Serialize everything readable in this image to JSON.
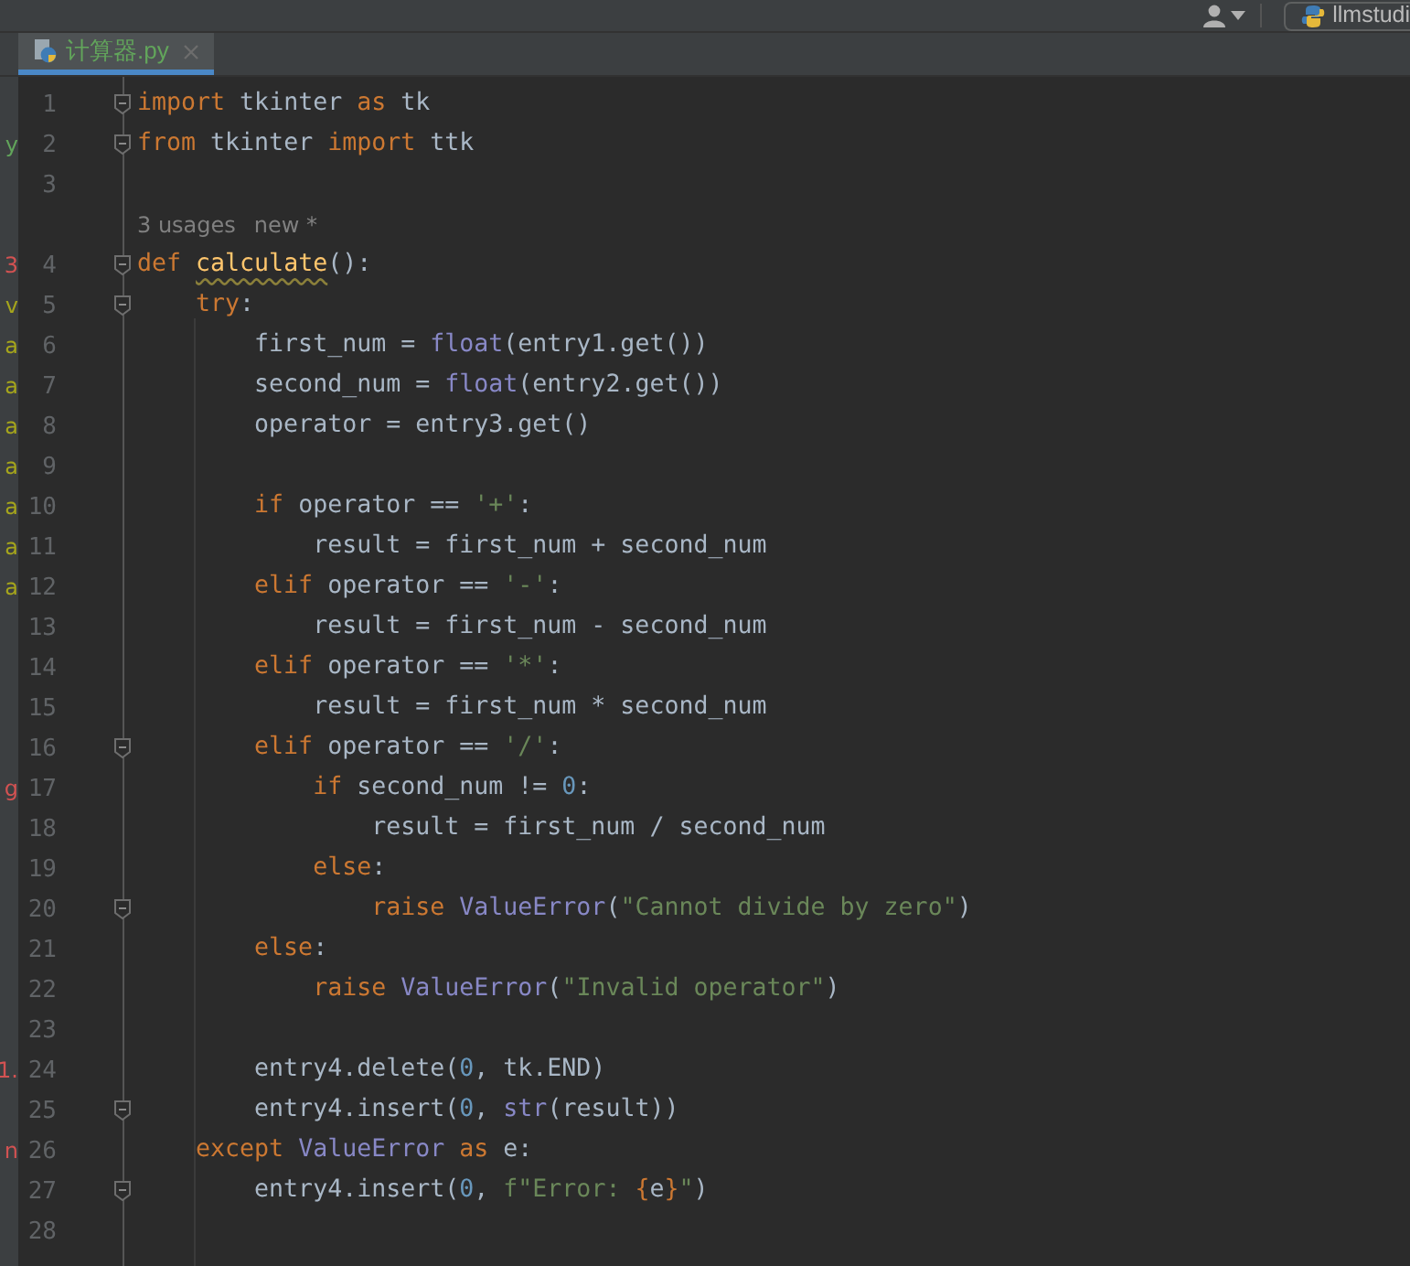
{
  "toolbar": {
    "run_config": "llmstudi"
  },
  "tabs": [
    {
      "label": "计算器.py",
      "selected": true
    }
  ],
  "lines": [
    {
      "number": "1",
      "fold": true,
      "tokens": [
        {
          "kind": "kw",
          "text": "import"
        },
        {
          "kind": "plain",
          "text": " tkinter "
        },
        {
          "kind": "kw",
          "text": "as"
        },
        {
          "kind": "plain",
          "text": " tk"
        }
      ]
    },
    {
      "number": "2",
      "fold": true,
      "strip": {
        "text": "y",
        "color": "#62a55b"
      },
      "tokens": [
        {
          "kind": "kw",
          "text": "from"
        },
        {
          "kind": "plain",
          "text": " tkinter "
        },
        {
          "kind": "kw",
          "text": "import"
        },
        {
          "kind": "plain",
          "text": " ttk"
        }
      ]
    },
    {
      "number": "3",
      "fold": false
    },
    {
      "kind": "hint",
      "usages": "3 usages",
      "author": "new *"
    },
    {
      "number": "4",
      "fold": true,
      "strip": {
        "text": "3",
        "color": "#d25252"
      },
      "tokens": [
        {
          "kind": "kw",
          "text": "def "
        },
        {
          "kind": "fn",
          "text": "calculate"
        },
        {
          "kind": "plain",
          "text": "():"
        }
      ]
    },
    {
      "number": "5",
      "fold": true,
      "strip": {
        "text": "v",
        "color": "#a5a51c"
      },
      "tokens": [
        {
          "kind": "kw",
          "text": "    try"
        },
        {
          "kind": "plain",
          "text": ":"
        }
      ]
    },
    {
      "number": "6",
      "fold": false,
      "strip": {
        "text": "a",
        "color": "#a5a51c"
      },
      "tokens": [
        {
          "kind": "plain",
          "text": "        first_num = "
        },
        {
          "kind": "builtin",
          "text": "float"
        },
        {
          "kind": "plain",
          "text": "(entry1.get())"
        }
      ]
    },
    {
      "number": "7",
      "fold": false,
      "strip": {
        "text": "a",
        "color": "#a5a51c"
      },
      "tokens": [
        {
          "kind": "plain",
          "text": "        second_num = "
        },
        {
          "kind": "builtin",
          "text": "float"
        },
        {
          "kind": "plain",
          "text": "(entry2.get())"
        }
      ]
    },
    {
      "number": "8",
      "fold": false,
      "strip": {
        "text": "a",
        "color": "#a5a51c"
      },
      "tokens": [
        {
          "kind": "plain",
          "text": "        operator = entry3.get()"
        }
      ]
    },
    {
      "number": "9",
      "fold": false,
      "strip": {
        "text": "a",
        "color": "#a5a51c"
      }
    },
    {
      "number": "10",
      "fold": false,
      "strip": {
        "text": "a",
        "color": "#a5a51c"
      },
      "tokens": [
        {
          "kind": "kw",
          "text": "        if"
        },
        {
          "kind": "plain",
          "text": " operator == "
        },
        {
          "kind": "str",
          "text": "'+'"
        },
        {
          "kind": "plain",
          "text": ":"
        }
      ]
    },
    {
      "number": "11",
      "fold": false,
      "strip": {
        "text": "a",
        "color": "#a5a51c"
      },
      "tokens": [
        {
          "kind": "plain",
          "text": "            result = first_num + second_num"
        }
      ]
    },
    {
      "number": "12",
      "fold": false,
      "strip": {
        "text": "a",
        "color": "#a5a51c"
      },
      "tokens": [
        {
          "kind": "kw",
          "text": "        elif"
        },
        {
          "kind": "plain",
          "text": " operator == "
        },
        {
          "kind": "str",
          "text": "'-'"
        },
        {
          "kind": "plain",
          "text": ":"
        }
      ]
    },
    {
      "number": "13",
      "fold": false,
      "tokens": [
        {
          "kind": "plain",
          "text": "            result = first_num - second_num"
        }
      ]
    },
    {
      "number": "14",
      "fold": false,
      "tokens": [
        {
          "kind": "kw",
          "text": "        elif"
        },
        {
          "kind": "plain",
          "text": " operator == "
        },
        {
          "kind": "str",
          "text": "'*'"
        },
        {
          "kind": "plain",
          "text": ":"
        }
      ]
    },
    {
      "number": "15",
      "fold": false,
      "tokens": [
        {
          "kind": "plain",
          "text": "            result = first_num * second_num"
        }
      ]
    },
    {
      "number": "16",
      "fold": true,
      "tokens": [
        {
          "kind": "kw",
          "text": "        elif"
        },
        {
          "kind": "plain",
          "text": " operator == "
        },
        {
          "kind": "str",
          "text": "'/'"
        },
        {
          "kind": "plain",
          "text": ":"
        }
      ]
    },
    {
      "number": "17",
      "fold": false,
      "strip": {
        "text": "g",
        "color": "#d25252"
      },
      "tokens": [
        {
          "kind": "kw",
          "text": "            if"
        },
        {
          "kind": "plain",
          "text": " second_num != "
        },
        {
          "kind": "num",
          "text": "0"
        },
        {
          "kind": "plain",
          "text": ":"
        }
      ]
    },
    {
      "number": "18",
      "fold": false,
      "tokens": [
        {
          "kind": "plain",
          "text": "                result = first_num / second_num"
        }
      ]
    },
    {
      "number": "19",
      "fold": false,
      "tokens": [
        {
          "kind": "kw",
          "text": "            else"
        },
        {
          "kind": "plain",
          "text": ":"
        }
      ]
    },
    {
      "number": "20",
      "fold": true,
      "tokens": [
        {
          "kind": "kw",
          "text": "                raise "
        },
        {
          "kind": "builtin",
          "text": "ValueError"
        },
        {
          "kind": "plain",
          "text": "("
        },
        {
          "kind": "str",
          "text": "\"Cannot divide by zero\""
        },
        {
          "kind": "plain",
          "text": ")"
        }
      ]
    },
    {
      "number": "21",
      "fold": false,
      "tokens": [
        {
          "kind": "kw",
          "text": "        else"
        },
        {
          "kind": "plain",
          "text": ":"
        }
      ]
    },
    {
      "number": "22",
      "fold": false,
      "tokens": [
        {
          "kind": "kw",
          "text": "            raise "
        },
        {
          "kind": "builtin",
          "text": "ValueError"
        },
        {
          "kind": "plain",
          "text": "("
        },
        {
          "kind": "str",
          "text": "\"Invalid operator\""
        },
        {
          "kind": "plain",
          "text": ")"
        }
      ]
    },
    {
      "number": "23",
      "fold": false
    },
    {
      "number": "24",
      "fold": false,
      "strip": {
        "text": "1.",
        "color": "#d25252"
      },
      "tokens": [
        {
          "kind": "plain",
          "text": "        entry4.delete("
        },
        {
          "kind": "num",
          "text": "0"
        },
        {
          "kind": "plain",
          "text": ", tk.END)"
        }
      ]
    },
    {
      "number": "25",
      "fold": true,
      "tokens": [
        {
          "kind": "plain",
          "text": "        entry4.insert("
        },
        {
          "kind": "num",
          "text": "0"
        },
        {
          "kind": "plain",
          "text": ", "
        },
        {
          "kind": "builtin",
          "text": "str"
        },
        {
          "kind": "plain",
          "text": "(result))"
        }
      ]
    },
    {
      "number": "26",
      "fold": false,
      "strip": {
        "text": "n",
        "color": "#d25252"
      },
      "tokens": [
        {
          "kind": "kw",
          "text": "    except "
        },
        {
          "kind": "builtin",
          "text": "ValueError"
        },
        {
          "kind": "kw",
          "text": " as"
        },
        {
          "kind": "plain",
          "text": " e:"
        }
      ]
    },
    {
      "number": "27",
      "fold": true,
      "tokens": [
        {
          "kind": "plain",
          "text": "        entry4.insert("
        },
        {
          "kind": "num",
          "text": "0"
        },
        {
          "kind": "plain",
          "text": ", "
        },
        {
          "kind": "str",
          "text": "f\"Error: "
        },
        {
          "kind": "kw",
          "text": "{"
        },
        {
          "kind": "plain",
          "text": "e"
        },
        {
          "kind": "kw",
          "text": "}"
        },
        {
          "kind": "str",
          "text": "\""
        },
        {
          "kind": "plain",
          "text": ")"
        }
      ]
    },
    {
      "number": "28",
      "fold": false
    }
  ]
}
